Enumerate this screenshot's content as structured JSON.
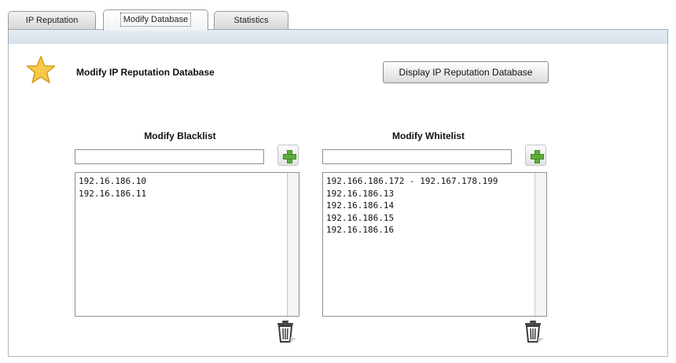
{
  "tabs": [
    {
      "label": "IP Reputation",
      "active": false
    },
    {
      "label": "Modify Database",
      "active": true
    },
    {
      "label": "Statistics",
      "active": false
    }
  ],
  "header": {
    "title": "Modify IP Reputation Database",
    "icon": "star-icon",
    "display_button_label": "Display IP Reputation Database"
  },
  "blacklist": {
    "title": "Modify Blacklist",
    "input_value": "",
    "add_icon": "plus-icon",
    "delete_icon": "trash-icon",
    "items": [
      "192.16.186.10",
      "192.16.186.11"
    ]
  },
  "whitelist": {
    "title": "Modify Whitelist",
    "input_value": "",
    "add_icon": "plus-icon",
    "delete_icon": "trash-icon",
    "items": [
      "192.166.186.172 - 192.167.178.199",
      "192.16.186.13",
      "192.16.186.14",
      "192.16.186.15",
      "192.16.186.16"
    ]
  },
  "colors": {
    "accent_band": "#d7e1ea",
    "star": "#f7c948",
    "add_icon": "#5fae3c"
  }
}
